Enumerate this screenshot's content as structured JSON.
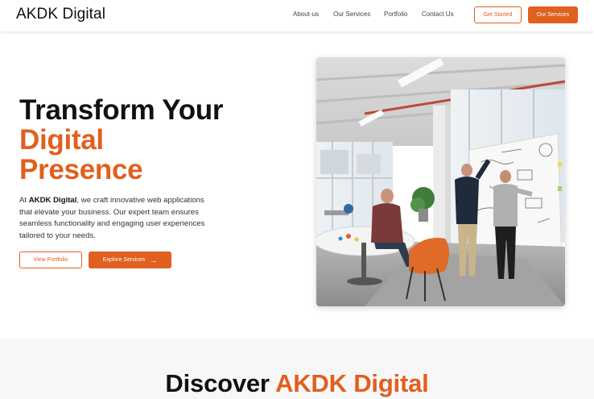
{
  "nav": {
    "brand": "AKDK Digital",
    "links": [
      "About-us",
      "Our Services",
      "Portfolio",
      "Contact Us"
    ],
    "get_started": "Get Started",
    "our_services": "Our Services"
  },
  "hero": {
    "title_line1": "Transform Your",
    "title_line2": "Digital",
    "title_line3": "Presence",
    "desc_prefix": "At ",
    "desc_brand": "AKDK Digital",
    "desc_rest": ", we craft innovative web applications that elevate your business. Our expert team ensures seamless functionality and engaging user experiences tailored to your needs.",
    "view_portfolio": "View Portfolio",
    "explore_services": "Explore Services",
    "arrow": "→"
  },
  "discover": {
    "prefix": "Discover ",
    "brand": "AKDK Digital"
  },
  "colors": {
    "accent": "#e0601f",
    "text": "#111111",
    "band": "#f7f7f8"
  }
}
